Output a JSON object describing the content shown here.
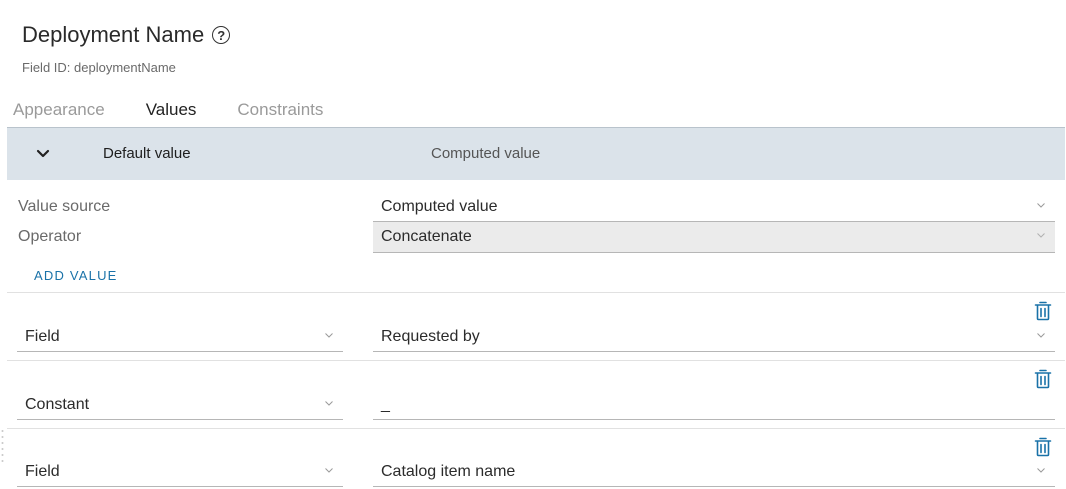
{
  "header": {
    "title": "Deployment Name",
    "field_id": "Field ID: deploymentName"
  },
  "tabs": [
    {
      "label": "Appearance",
      "active": false
    },
    {
      "label": "Values",
      "active": true
    },
    {
      "label": "Constraints",
      "active": false
    }
  ],
  "accordion": {
    "title": "Default value",
    "summary": "Computed value"
  },
  "value_source": {
    "label": "Value source",
    "value": "Computed value"
  },
  "operator": {
    "label": "Operator",
    "value": "Concatenate"
  },
  "add_value_label": "ADD VALUE",
  "rows": [
    {
      "type": "Field",
      "value": "Requested by"
    },
    {
      "type": "Constant",
      "value": "_"
    },
    {
      "type": "Field",
      "value": "Catalog item name"
    }
  ],
  "colors": {
    "accent": "#1a72a8",
    "accordion_bg": "#dbe3ea",
    "disabled_bg": "#ebebeb"
  }
}
